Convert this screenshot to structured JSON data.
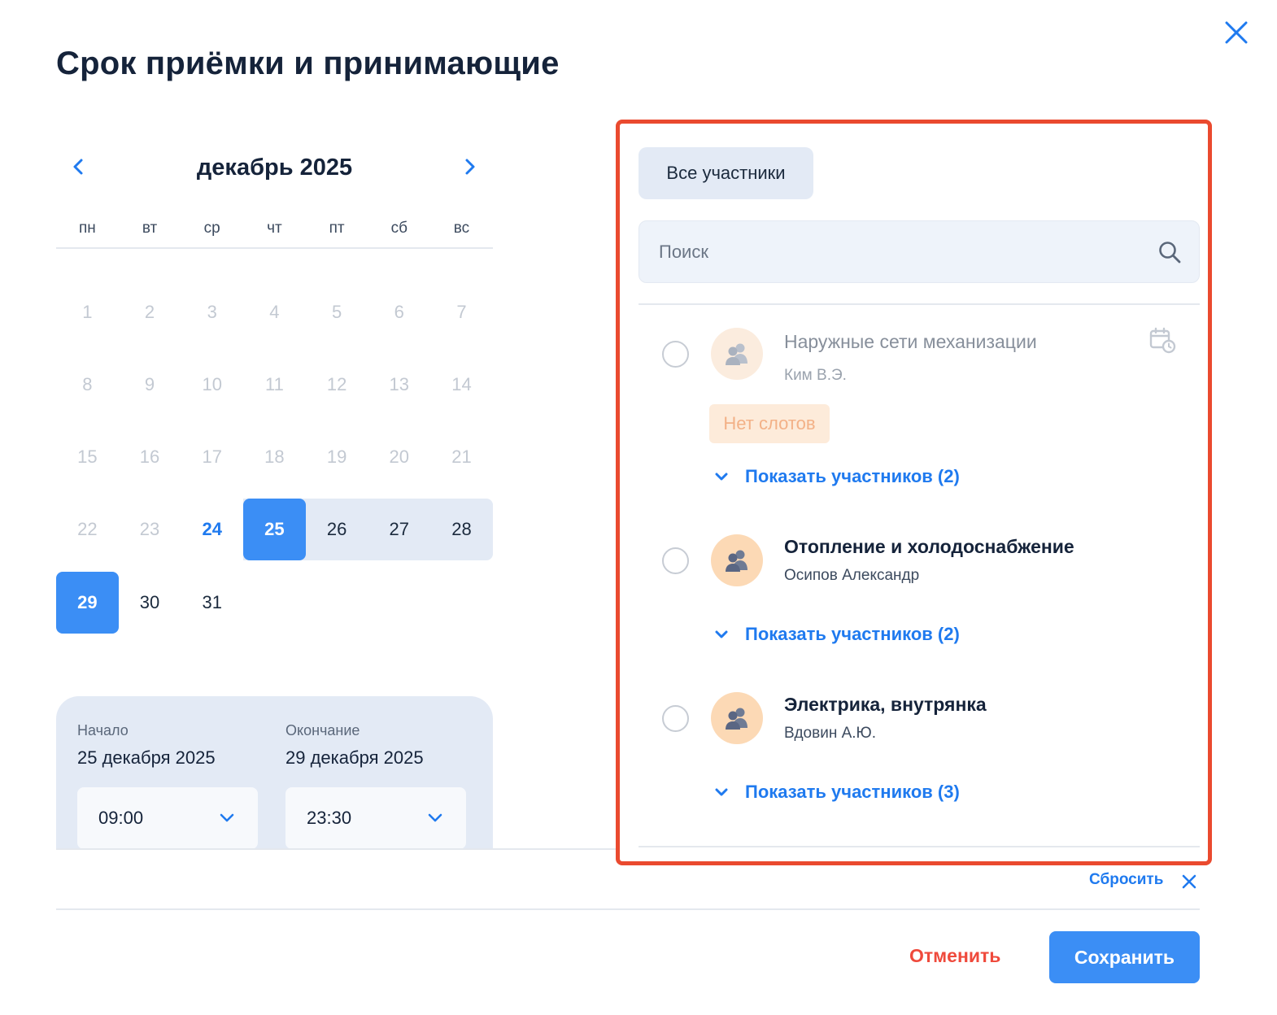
{
  "modal": {
    "title": "Срок приёмки и принимающие",
    "close_icon": "close-icon"
  },
  "calendar": {
    "month_label": "декабрь 2025",
    "weekdays": [
      "пн",
      "вт",
      "ср",
      "чт",
      "пт",
      "сб",
      "вс"
    ],
    "weeks": [
      [
        "1",
        "2",
        "3",
        "4",
        "5",
        "6",
        "7"
      ],
      [
        "8",
        "9",
        "10",
        "11",
        "12",
        "13",
        "14"
      ],
      [
        "15",
        "16",
        "17",
        "18",
        "19",
        "20",
        "21"
      ],
      [
        "22",
        "23",
        "24",
        "25",
        "26",
        "27",
        "28"
      ],
      [
        "29",
        "30",
        "31"
      ]
    ],
    "today": "24",
    "range_start": "25",
    "range_end": "29"
  },
  "range": {
    "start_label": "Начало",
    "start_date": "25 декабря 2025",
    "start_time": "09:00",
    "end_label": "Окончание",
    "end_date": "29 декабря 2025",
    "end_time": "23:30"
  },
  "participants": {
    "all_button": "Все участники",
    "search_placeholder": "Поиск",
    "groups": [
      {
        "name": "Наружные сети механизации",
        "person": "Ким В.Э.",
        "badge": "Нет слотов",
        "show_more": "Показать участников (2)"
      },
      {
        "name": "Отопление и холодоснабжение",
        "person": "Осипов Александр",
        "show_more": "Показать участников (2)"
      },
      {
        "name": "Электрика, внутрянка",
        "person": "Вдовин А.Ю.",
        "show_more": "Показать участников (3)"
      }
    ]
  },
  "footer": {
    "reset": "Сбросить",
    "cancel": "Отменить",
    "save": "Сохранить"
  },
  "colors": {
    "accent": "#3b8ef5",
    "link": "#1f7aef",
    "danger": "#ef4a3c",
    "highlight_border": "#ea4a2f",
    "badge_bg": "#fdebda"
  }
}
